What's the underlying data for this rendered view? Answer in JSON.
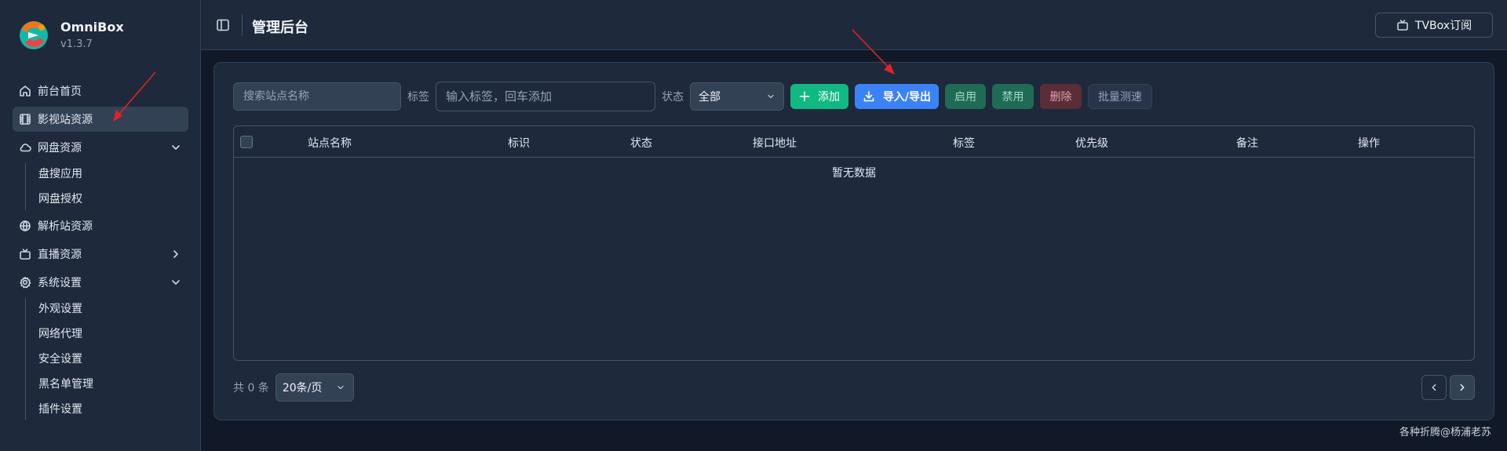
{
  "app": {
    "name": "OmniBox",
    "version": "v1.3.7"
  },
  "sidebar": {
    "items": [
      {
        "label": "前台首页",
        "icon": "home-icon"
      },
      {
        "label": "影视站资源",
        "icon": "film-icon",
        "active": true
      },
      {
        "label": "网盘资源",
        "icon": "cloud-icon",
        "expanded": true,
        "children": [
          "盘搜应用",
          "网盘授权"
        ]
      },
      {
        "label": "解析站资源",
        "icon": "globe-icon"
      },
      {
        "label": "直播资源",
        "icon": "tv-icon",
        "expanded": false
      },
      {
        "label": "系统设置",
        "icon": "gear-icon",
        "expanded": true,
        "children": [
          "外观设置",
          "网络代理",
          "安全设置",
          "黑名单管理",
          "插件设置"
        ]
      }
    ]
  },
  "header": {
    "title": "管理后台",
    "tvbox_label": "TVBox订阅"
  },
  "toolbar": {
    "search_placeholder": "搜索站点名称",
    "tag_label": "标签",
    "tag_placeholder": "输入标签，回车添加",
    "status_label": "状态",
    "status_value": "全部",
    "add_label": "添加",
    "import_export_label": "导入/导出",
    "enable_label": "启用",
    "disable_label": "禁用",
    "delete_label": "删除",
    "batch_test_label": "批量测速"
  },
  "table": {
    "columns": [
      "站点名称",
      "标识",
      "状态",
      "接口地址",
      "标签",
      "优先级",
      "备注",
      "操作"
    ],
    "empty_text": "暂无数据"
  },
  "pagination": {
    "total_text": "共 0 条",
    "page_size": "20条/页"
  },
  "credit": "各种折腾@杨浦老苏",
  "colors": {
    "sidebar_bg": "#1e293b",
    "page_bg": "#111827",
    "add_green": "#10b981",
    "primary_blue": "#3b82f6",
    "annotation_red": "#e02424"
  }
}
